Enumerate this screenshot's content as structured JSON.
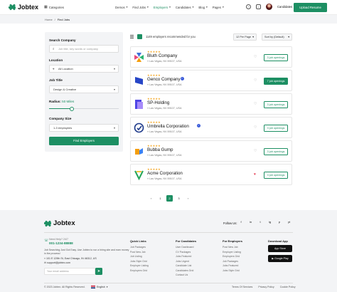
{
  "header": {
    "logo_text": "Jobtex",
    "categories_label": "Categories",
    "nav": [
      {
        "label": "Demos",
        "active": false
      },
      {
        "label": "Find Jobs",
        "active": false
      },
      {
        "label": "Employers",
        "active": true
      },
      {
        "label": "Candidates",
        "active": false
      },
      {
        "label": "Blog",
        "active": false
      },
      {
        "label": "Pages",
        "active": false
      }
    ],
    "notification_count": "2",
    "user_name": "Candidates",
    "upload_button": "Upload Resume"
  },
  "breadcrumb": {
    "home": "Home",
    "separator": "/",
    "current": "Find Jobs"
  },
  "filters": {
    "search_company_label": "Search Company",
    "search_placeholder": "Job title, key words or company",
    "location_label": "Location",
    "location_value": "All Location",
    "job_title_label": "Job Title",
    "job_title_value": "Design & Creative",
    "radius_label": "Radius:",
    "radius_value": "50 Miles",
    "radius_fraction": 0.33,
    "company_size_label": "Company Size",
    "company_size_value": "1-3 employees",
    "find_button": "Find Employers"
  },
  "toolbar": {
    "count_text": "1149 employers recommended for you",
    "per_page": "12 Per Page",
    "sort": "Sort by (Default)"
  },
  "companies": [
    {
      "name": "Bluth Company",
      "location": "Las Vegas, NV 89107, USA",
      "stars": "★★★★★",
      "verified": false,
      "favorite": false,
      "openings": "3 job openings",
      "highlight": false,
      "logo": "bluth-logo"
    },
    {
      "name": "Genco Company",
      "location": "Las Vegas, NV 89107, USA",
      "stars": "★★★★★",
      "verified": true,
      "favorite": false,
      "openings": "7 job openings",
      "highlight": true,
      "logo": "genco-logo"
    },
    {
      "name": "SP-Holding",
      "location": "Las Vegas, NV 89107, USA",
      "stars": "★★★★★",
      "verified": false,
      "favorite": false,
      "openings": "3 job openings",
      "highlight": false,
      "logo": "sp-holding-logo"
    },
    {
      "name": "Umbrella Corporation",
      "location": "Las Vegas, NV 89107, USA",
      "stars": "★★★★★",
      "verified": true,
      "favorite": false,
      "openings": "3 job openings",
      "highlight": false,
      "logo": "umbrella-logo"
    },
    {
      "name": "Bubba Gump",
      "location": "Las Vegas, NV 89107, USA",
      "stars": "★★★★★",
      "verified": false,
      "favorite": false,
      "openings": "3 job openings",
      "highlight": false,
      "logo": "bubba-gump-logo"
    },
    {
      "name": "Acme Corporation",
      "location": "Las Vegas, NV 89107, USA",
      "stars": "★★★★★",
      "verified": false,
      "favorite": true,
      "openings": "3 job openings",
      "highlight": false,
      "logo": "acme-logo"
    }
  ],
  "pagination": {
    "prev": "‹",
    "pages": [
      "1",
      "2",
      "3"
    ],
    "current": "2",
    "next": "›"
  },
  "footer": {
    "logo_text": "Jobtex",
    "follow_label": "Follow Us:",
    "socials": [
      "f",
      "in",
      "t",
      "ig",
      "p",
      "yt"
    ],
    "need_help": "Need Help? 24/7",
    "phone": "001-1234-88888",
    "description": "Job Searching Just Got Easy. Use Jobtex to run a hiring site and earn money in the process!",
    "address": "101 E 129th St, East Chicago, IN 46312, US",
    "email": "support@jobtex.com",
    "newsletter_placeholder": "Your email address",
    "columns": [
      {
        "title": "Quick Links",
        "items": [
          "Job Packages",
          "Post New Job",
          "Job Listing",
          "Jobs Style Grid",
          "Employer Listing",
          "Employers Grid"
        ]
      },
      {
        "title": "For Candidates",
        "items": [
          "User Dashboard",
          "CV Packages",
          "Jobs Featured",
          "Jobs Urgent",
          "Candidate List",
          "Candidates Grid",
          "Contact Us"
        ]
      },
      {
        "title": "For Employers",
        "items": [
          "Post New Job",
          "Employer Listing",
          "Employers Grid",
          "Job Packages",
          "Jobs Featured",
          "Jobs Style Grid"
        ]
      }
    ],
    "download_title": "Download App",
    "app_store": "App Store",
    "google_play": "Google Play",
    "copyright": "© 2023 Jobtex. All Rights Reserved.",
    "language": "English",
    "legal": [
      "Terms Of Services",
      "Privacy Policy",
      "Cookie Policy"
    ]
  },
  "colors": {
    "accent": "#1d8f63",
    "star": "#f5a623",
    "heart_active": "#e53950",
    "verified": "#3a5bd9"
  }
}
